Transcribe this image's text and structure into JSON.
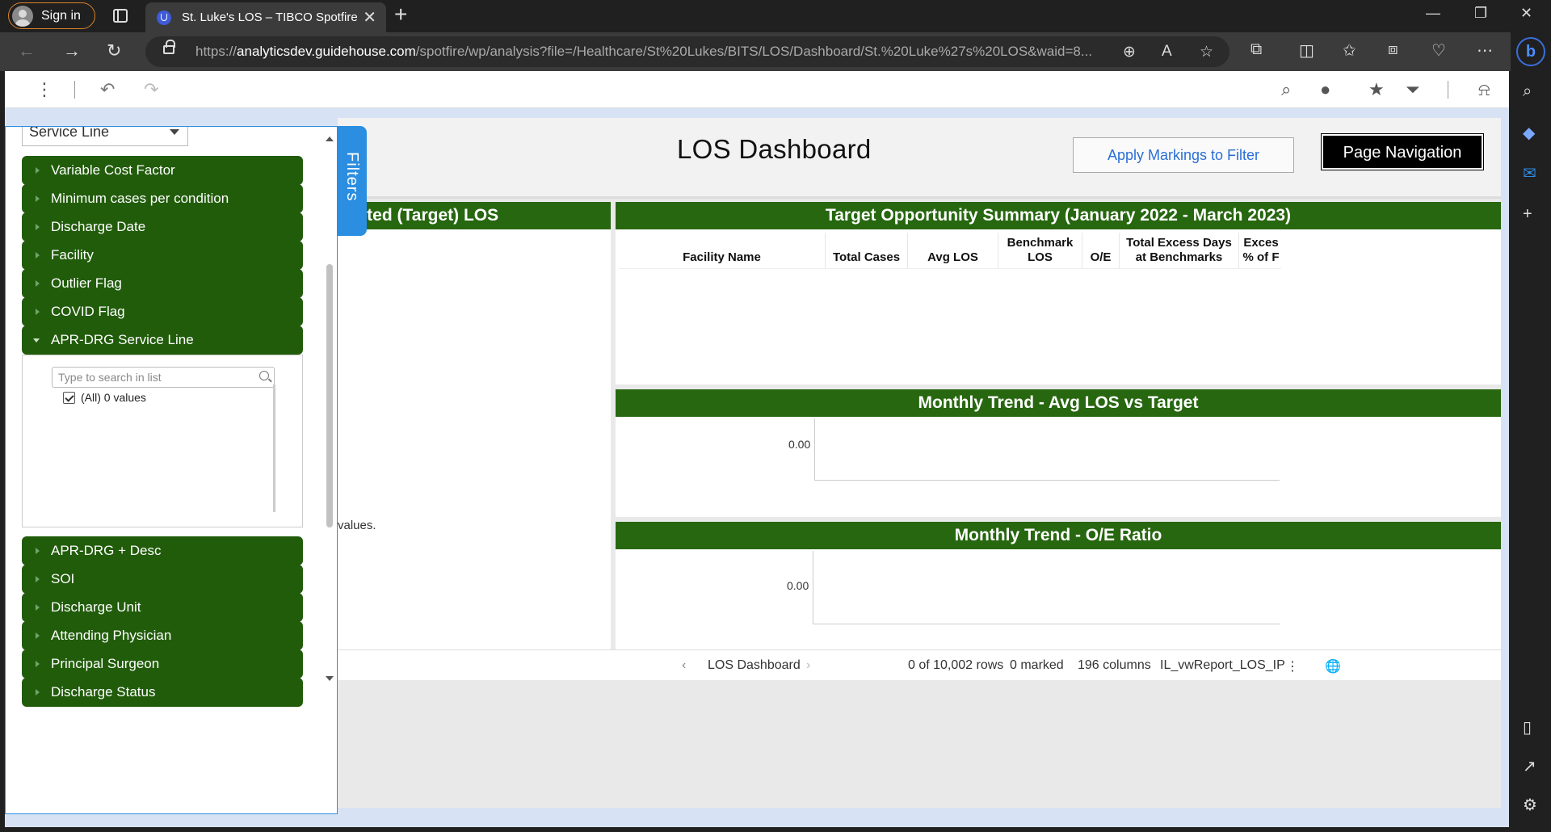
{
  "browser": {
    "signin_label": "Sign in",
    "tab_title": "St. Luke's LOS – TIBCO Spotfire",
    "url_scheme": "https://",
    "url_host": "analyticsdev.guidehouse.com",
    "url_path": "/spotfire/wp/analysis?file=/Healthcare/St%20Lukes/BITS/LOS/Dashboard/St.%20Luke%27s%20LOS&waid=8..."
  },
  "filters": {
    "tab_label": "Filters",
    "dropdown_value": "Service Line",
    "items_top": [
      "Variable Cost Factor",
      "Minimum cases per condition",
      "Discharge Date",
      "Facility",
      "Outlier Flag",
      "COVID Flag",
      "APR-DRG Service Line"
    ],
    "search_placeholder": "Type to search in list",
    "all_values_label": "(All) 0 values",
    "items_bottom": [
      "APR-DRG + Desc",
      "SOI",
      "Discharge Unit",
      "Attending Physician",
      "Principal Surgeon",
      "Discharge Status"
    ]
  },
  "dashboard": {
    "title": "LOS Dashboard",
    "apply_markings_label": "Apply Markings to Filter",
    "page_navigation_label": "Page Navigation",
    "left_panel_title": "pected (Target) LOS",
    "left_panel_message": "values.",
    "summary_title": "Target Opportunity Summary (January 2022 - March 2023)",
    "summary_columns": [
      "Facility Name",
      "Total Cases",
      "Avg LOS",
      "Benchmark LOS",
      "O/E",
      "Total Excess Days at Benchmarks",
      "Exces % of F"
    ],
    "trend_avg_title": "Monthly Trend - Avg LOS vs Target",
    "trend_avg_axis_value": "0.00",
    "trend_oe_title": "Monthly Trend - O/E Ratio",
    "trend_oe_axis_value": "0.00"
  },
  "status": {
    "page_name": "LOS Dashboard",
    "rows": "0 of 10,002 rows",
    "marked": "0 marked",
    "columns": "196 columns",
    "table_name": "IL_vwReport_LOS_IP"
  }
}
